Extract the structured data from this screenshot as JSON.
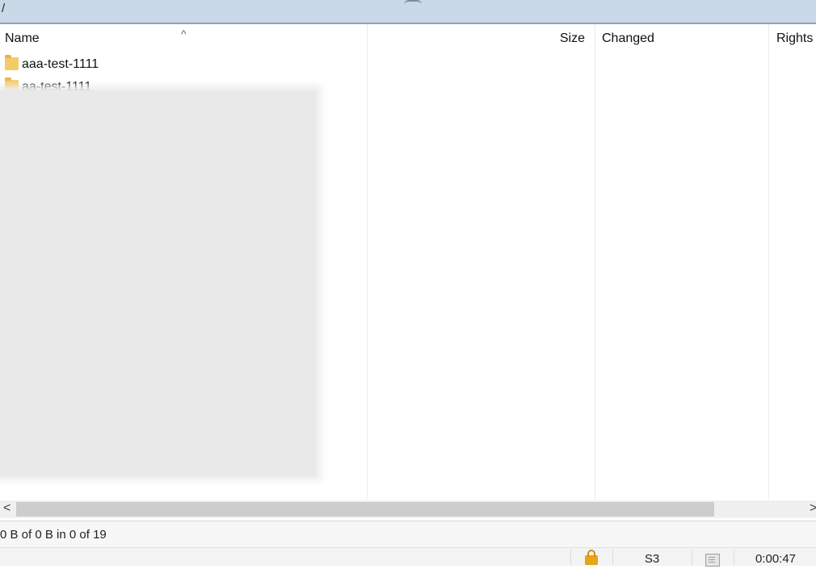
{
  "path_bar": {
    "path": "/"
  },
  "columns": {
    "name": "Name",
    "size": "Size",
    "changed": "Changed",
    "rights": "Rights",
    "sort_indicator": "^"
  },
  "files": [
    {
      "name": "aaa-test-1111",
      "icon": "folder-icon"
    },
    {
      "name": "aa-test-1111",
      "icon": "folder-icon"
    }
  ],
  "scrollbar": {
    "left_arrow": "<",
    "right_arrow": ">"
  },
  "status": {
    "selection": "0 B of 0 B in 0 of 19",
    "protocol": "S3",
    "elapsed": "0:00:47"
  },
  "colors": {
    "path_bar_bg": "#c9d9e8",
    "folder": "#f3cc68",
    "lock": "#e8a317"
  }
}
